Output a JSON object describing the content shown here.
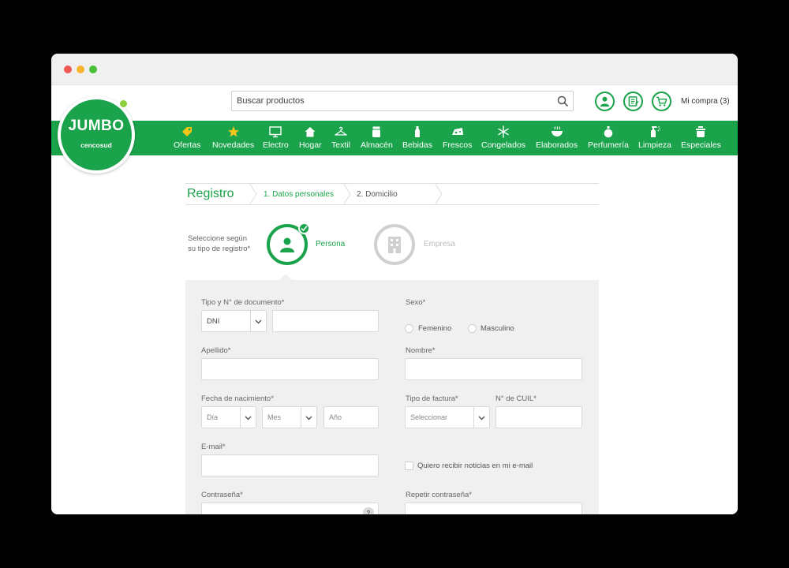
{
  "brand": {
    "name": "JUMBO",
    "subtitle": "cencosud",
    "primary_color": "#1aa34a",
    "accent_color": "#8ccd3c"
  },
  "header": {
    "search_placeholder": "Buscar productos",
    "icons": [
      "user-icon",
      "list-icon",
      "cart-icon"
    ],
    "cart_label": "Mi compra (3)"
  },
  "nav": {
    "items": [
      {
        "label": "Ofertas",
        "icon": "tag-icon"
      },
      {
        "label": "Novedades",
        "icon": "star-icon"
      },
      {
        "label": "Electro",
        "icon": "monitor-icon"
      },
      {
        "label": "Hogar",
        "icon": "house-icon"
      },
      {
        "label": "Textil",
        "icon": "hanger-icon"
      },
      {
        "label": "Almacén",
        "icon": "jar-icon"
      },
      {
        "label": "Bebidas",
        "icon": "bottle-icon"
      },
      {
        "label": "Frescos",
        "icon": "cheese-icon"
      },
      {
        "label": "Congelados",
        "icon": "snowflake-icon"
      },
      {
        "label": "Elaborados",
        "icon": "bowl-icon"
      },
      {
        "label": "Perfumería",
        "icon": "perfume-icon"
      },
      {
        "label": "Limpieza",
        "icon": "spray-icon"
      },
      {
        "label": "Especiales",
        "icon": "pot-icon"
      }
    ]
  },
  "registro": {
    "title": "Registro",
    "steps": [
      "1. Datos personales",
      "2. Domicilio"
    ],
    "active_step": 1
  },
  "tipo": {
    "label_line1": "Seleccione según",
    "label_line2": "su tipo de registro*",
    "options": [
      "Persona",
      "Empresa"
    ],
    "selected": "Persona"
  },
  "form": {
    "doc_label": "Tipo y N° de documento*",
    "doc_type": "DNI",
    "sexo_label": "Sexo*",
    "sexo_options": [
      "Femenino",
      "Masculino"
    ],
    "apellido_label": "Apellido*",
    "nombre_label": "Nombre*",
    "nacimiento_label": "Fecha de nacimiento*",
    "dia": "Día",
    "mes": "Mes",
    "anio": "Año",
    "factura_label": "Tipo de factura*",
    "factura_value": "Seleccionar",
    "cuil_label": "N° de CUIL*",
    "email_label": "E-mail*",
    "newsletter_label": "Quiero recibir noticias en mi e-mail",
    "password_label": "Contraseña*",
    "password_help": "?",
    "repeat_password_label": "Repetir contraseña*"
  }
}
